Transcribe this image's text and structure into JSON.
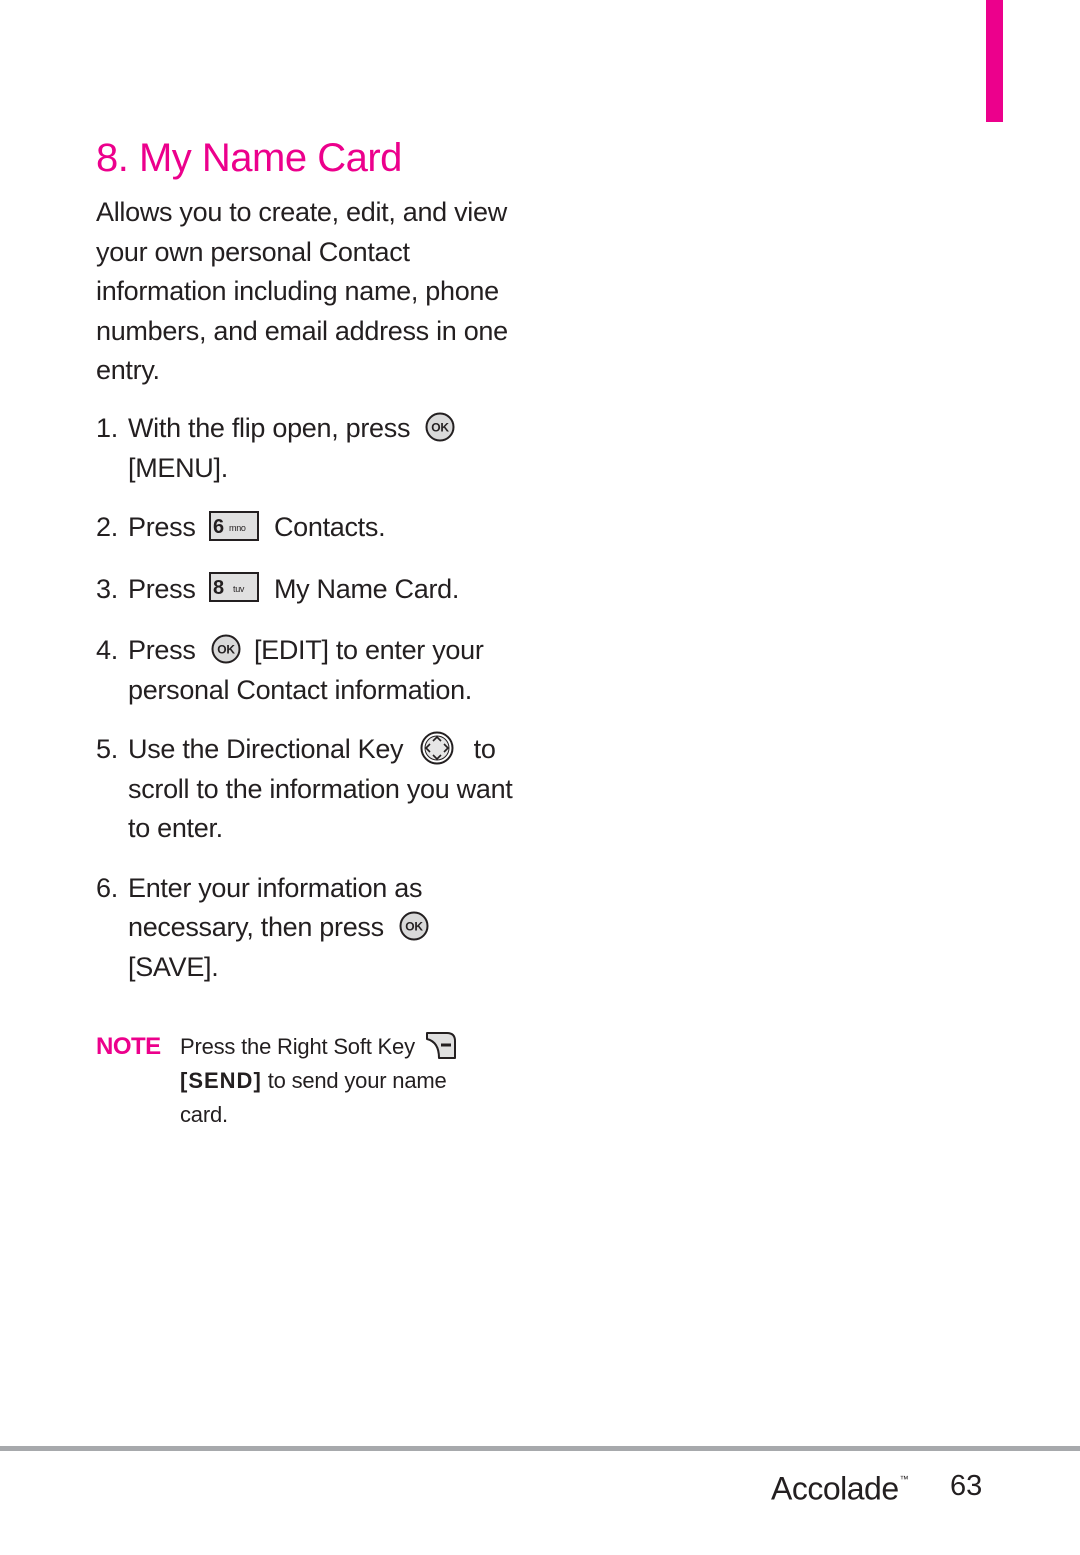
{
  "page": {
    "accent_color": "#ec008c",
    "rule_color": "#a7a9ac"
  },
  "section": {
    "title": "8. My Name Card",
    "intro": "Allows you to create, edit, and view your own personal Contact information including name, phone numbers, and email address in one entry."
  },
  "steps": [
    {
      "number": "1.",
      "before": "With the flip open, press",
      "icon": "ok-key-icon",
      "icon_text": "OK",
      "after": "[MENU]."
    },
    {
      "number": "2.",
      "before": "Press",
      "icon": "keypad-6-icon",
      "key_digit": "6",
      "key_letters": "mno",
      "after": "Contacts."
    },
    {
      "number": "3.",
      "before": "Press",
      "icon": "keypad-8-icon",
      "key_digit": "8",
      "key_letters": "tuv",
      "after": "My Name Card."
    },
    {
      "number": "4.",
      "before": "Press",
      "icon": "ok-key-icon",
      "icon_text": "OK",
      "after": "[EDIT] to enter your personal Contact information."
    },
    {
      "number": "5.",
      "before": "Use the Directional Key",
      "icon": "directional-key-icon",
      "after": "to scroll to the information you want to enter."
    },
    {
      "number": "6.",
      "before": "Enter your information as necessary, then press",
      "icon": "ok-key-icon",
      "icon_text": "OK",
      "after": "[SAVE]."
    }
  ],
  "note": {
    "label": "NOTE",
    "text_before": "Press the Right Soft Key",
    "icon": "right-soft-key-icon",
    "bold_text": "[SEND]",
    "text_after": "to send your name card."
  },
  "footer": {
    "brand": "Accolade",
    "trademark": "™",
    "page_number": "63"
  }
}
